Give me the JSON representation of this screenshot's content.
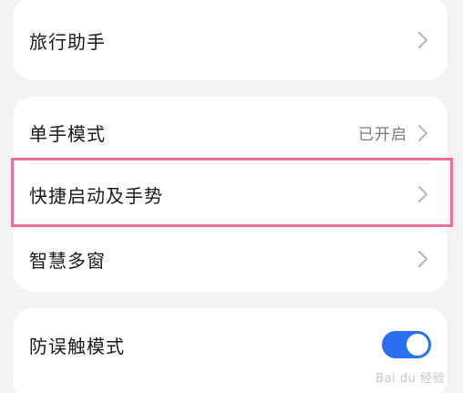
{
  "card1": {
    "items": [
      {
        "label": "旅行助手",
        "value": ""
      }
    ]
  },
  "card2": {
    "items": [
      {
        "label": "单手模式",
        "value": "已开启"
      },
      {
        "label": "快捷启动及手势",
        "value": ""
      },
      {
        "label": "智慧多窗",
        "value": ""
      }
    ]
  },
  "card3": {
    "items": [
      {
        "label": "防误触模式",
        "toggle_on": true
      }
    ]
  },
  "colors": {
    "background": "#f1f3f5",
    "card": "#ffffff",
    "accent": "#2a6ff2",
    "highlight": "#ee6f96"
  },
  "watermark": "Bai du 经验"
}
